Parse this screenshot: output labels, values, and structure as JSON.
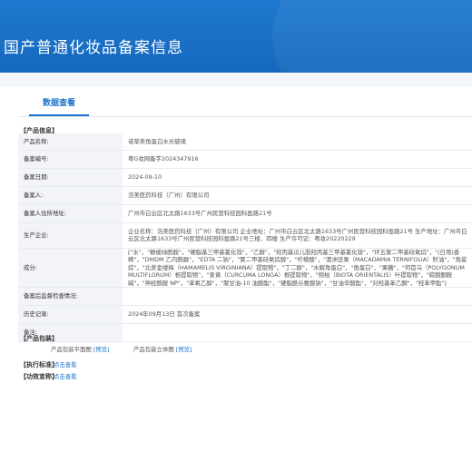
{
  "header": {
    "title": "国产普通化妆品备案信息"
  },
  "tabs": [
    {
      "label": "数据查看"
    }
  ],
  "product_info": {
    "section_title": "【产品信息】",
    "rows": [
      {
        "label": "产品名称:",
        "value": "诺草美角蛋白水光玻璃"
      },
      {
        "label": "备案编号:",
        "value": "粤G妆网备字2024347916"
      },
      {
        "label": "备案日期:",
        "value": "2024-09-10"
      },
      {
        "label": "备案人:",
        "value": "浩美医药科技（广州）有限公司"
      },
      {
        "label": "备案人住所地址:",
        "value": "广州市白云区北太路1633号广州民营科技园科盈路21号"
      },
      {
        "label": "生产企业:",
        "value": "企业名称：浩美医药科技（广州）有限公司 企业地址：广州市白云区北太路1633号广州民营科技园科盈路21号 生产地址：广州市白云区北太路1633号广州民营科技园科盈路21号三楼、四楼 生产许可证：粤妆20220229"
      },
      {
        "label": "成分:",
        "value": "[\"水\"，\"静缓绿酰胺\"，\"硬脂基三甲基氯化铵\"，\"乙醇\"，\"羟丙基瓜儿胶羟丙基三甲基氯化铵\"，\"环五聚二甲基硅氧烷\"，\"(日用)香精\"，\"DMDM 乙内酰脲\"，\"EDTA 二钠\"，\"聚二甲基硅氧烷醇\"，\"柠檬酸\"，\"澳洲坚果（MACADAMIA TERNIFOLIA）籽油\"，\"角鲨烷\"，\"北美金缕梅（HAMAMELIS VIRGINIANA）提取物\"，\"丁二醇\"，\"水解角蛋白\"，\"角蛋白\"，\"果糖\"，\"何首乌（POLYGONUM MULTIFLORUM）根提取物\"，\"姜黄（CURCUMA LONGA）根提取物\"，\"侧柏（BIOTA ORIENTALIS）叶提取物\"，\"碳酸酮胺碱\"，\"神经酰胺 NP\"，\"苯氧乙醇\"，\"聚甘油-10 油酸酯\"，\"硬脂酰谷氨酸钠\"，\"甘油辛酸酯\"，\"对羟基苯乙酮\"，\"羟苯甲酯\"]"
      },
      {
        "label": "备案后监督检查情况:",
        "value": ""
      },
      {
        "label": "历史记录:",
        "value": "2024年09月13日 首次备案"
      },
      {
        "label": "备注:",
        "value": ""
      }
    ]
  },
  "packaging": {
    "section_title": "【产品包装】",
    "items": [
      {
        "label": "产品包装平面图",
        "link": "[预览]"
      },
      {
        "label": "产品包装立体图",
        "link": "[预览]"
      }
    ]
  },
  "execution_standard": {
    "section_title": "【执行标准】",
    "link": "点击查看"
  },
  "efficacy_claim": {
    "section_title": "【功效宣称】",
    "link": "点击查看"
  }
}
